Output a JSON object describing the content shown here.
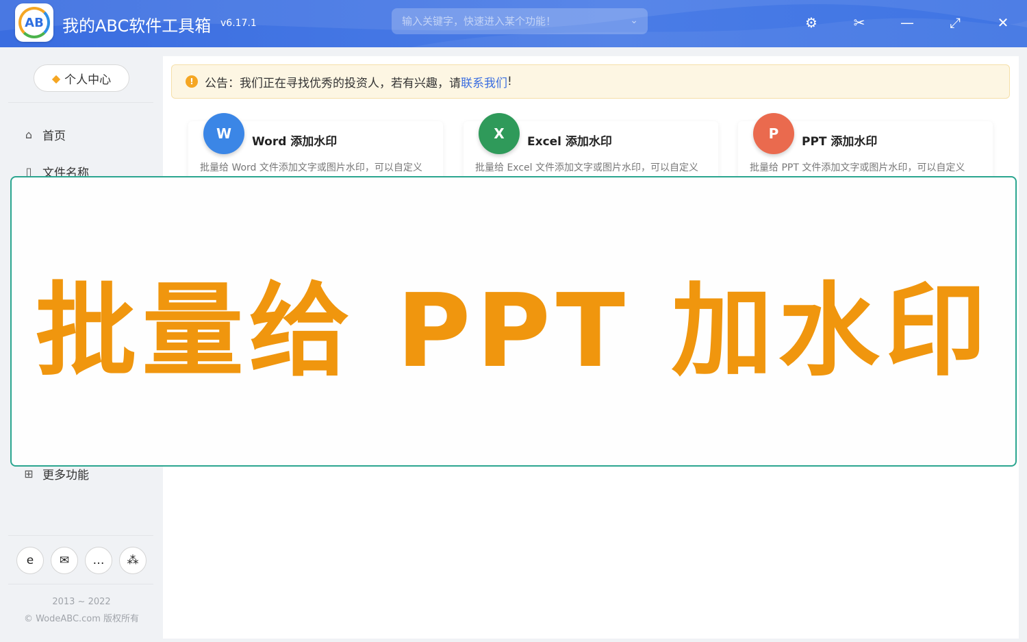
{
  "app": {
    "title": "我的ABC软件工具箱",
    "version": "v6.17.1",
    "logo_text": "AB",
    "search_placeholder": "输入关键字，快速进入某个功能！"
  },
  "window_controls": {
    "settings_icon": "⚙",
    "scissors_icon": "✂",
    "minimize_icon": "—",
    "maximize_icon": "⤢",
    "close_icon": "✕"
  },
  "sidebar": {
    "user_center": "个人中心",
    "items": [
      {
        "icon": "home-icon",
        "label": "首页"
      },
      {
        "icon": "file-icon",
        "label": "文件名称"
      },
      {
        "icon": "grid-icon",
        "label": "更多功能"
      }
    ],
    "footer_buttons": [
      "ie-icon",
      "mail-icon",
      "chat-icon",
      "share-icon"
    ],
    "copyright_years": "2013 ~ 2022",
    "copyright_text": "© WodeABC.com 版权所有"
  },
  "notice": {
    "prefix": "公告：我们正在寻找优秀的投资人，若有兴趣，请",
    "link": "联系我们",
    "suffix": "!"
  },
  "cards": [
    {
      "title": "Word 添加水印",
      "desc": "批量给 Word 文件添加文字或图片水印，可以自定义",
      "color": "#3b86e6",
      "letter": "W"
    },
    {
      "title": "Excel 添加水印",
      "desc": "批量给 Excel 文件添加文字或图片水印，可以自定义",
      "color": "#2f9a5a",
      "letter": "X"
    },
    {
      "title": "PPT 添加水印",
      "desc": "批量给 PPT 文件添加文字或图片水印，可以自定义",
      "color": "#ea6a4e",
      "letter": "P"
    }
  ],
  "overlay": {
    "text": "批量给 PPT 加水印",
    "color": "#f0960e",
    "border_color": "#2aa58f"
  },
  "colors": {
    "titlebar": "#3f74e3",
    "accent_link": "#3a6de0",
    "notice_bg": "#fdf6e3"
  }
}
